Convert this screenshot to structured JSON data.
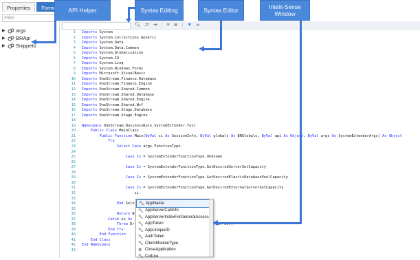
{
  "tabs": [
    "Properties",
    "Formula"
  ],
  "filter": {
    "placeholder": "Filter"
  },
  "tree": [
    "args",
    "BRApi",
    "Snippets"
  ],
  "toolbar": {
    "icons": [
      "find-icon",
      "replace-icon",
      "find-next-icon",
      "comment-icon",
      "uncomment-icon",
      "filter-icon",
      "glasses-icon"
    ]
  },
  "callouts": {
    "api_helper": "API Helper",
    "syntax_editing": "Syntax Editing",
    "syntax_editor": "Syntax Editor",
    "intelli_sense": "Intelli-Sense Window"
  },
  "code_lines": [
    {
      "n": "1",
      "fold": "",
      "t": "Imports System"
    },
    {
      "n": "2",
      "fold": "",
      "t": "Imports System.Collections.Generic"
    },
    {
      "n": "3",
      "fold": "",
      "t": "Imports System.Data"
    },
    {
      "n": "4",
      "fold": "",
      "t": "Imports System.Data.Common"
    },
    {
      "n": "5",
      "fold": "",
      "t": "Imports System.Globalization"
    },
    {
      "n": "6",
      "fold": "",
      "t": "Imports System.IO"
    },
    {
      "n": "7",
      "fold": "",
      "t": "Imports System.Linq"
    },
    {
      "n": "8",
      "fold": "",
      "t": "Imports System.Windows.Forms"
    },
    {
      "n": "9",
      "fold": "",
      "t": "Imports Microsoft.VisualBasic"
    },
    {
      "n": "10",
      "fold": "",
      "t": "Imports OneStream.Finance.Database"
    },
    {
      "n": "11",
      "fold": "",
      "t": "Imports OneStream.Finance.Engine"
    },
    {
      "n": "12",
      "fold": "",
      "t": "Imports OneStream.Shared.Common"
    },
    {
      "n": "13",
      "fold": "",
      "t": "Imports OneStream.Shared.Database"
    },
    {
      "n": "14",
      "fold": "",
      "t": "Imports OneStream.Shared.Engine"
    },
    {
      "n": "15",
      "fold": "",
      "t": "Imports OneStream.Shared.Wcf"
    },
    {
      "n": "16",
      "fold": "",
      "t": "Imports OneStream.Stage.Database"
    },
    {
      "n": "17",
      "fold": "",
      "t": "Imports OneStream.Stage.Engine"
    },
    {
      "n": "18",
      "fold": "",
      "t": ""
    },
    {
      "n": "19",
      "fold": "-",
      "t": "Namespace OneStream.BusinessRule.SystemExtender.Test"
    },
    {
      "n": "20",
      "fold": "-",
      "t": "    Public Class MainClass"
    },
    {
      "n": "21",
      "fold": "-",
      "t": "        Public Function Main(ByVal si As SessionInfo, ByVal globals As BRGlobals, ByVal api As Object, ByVal args As SystemExtenderArgs) As Object"
    },
    {
      "n": "22",
      "fold": "",
      "t": "            Try"
    },
    {
      "n": "23",
      "fold": "",
      "t": "                Select Case args.FunctionType"
    },
    {
      "n": "24",
      "fold": "",
      "t": ""
    },
    {
      "n": "25",
      "fold": "",
      "t": "                    Case Is = SystemExtenderFunctionType.Unknown"
    },
    {
      "n": "26",
      "fold": "",
      "t": ""
    },
    {
      "n": "27",
      "fold": "",
      "t": "                    Case Is = SystemExtenderFunctionType.GetDesiredServerSetCapacity"
    },
    {
      "n": "28",
      "fold": "",
      "t": ""
    },
    {
      "n": "29",
      "fold": "",
      "t": "                    Case Is = SystemExtenderFunctionType.GetDesiredElasticDatabasePoolCapacity"
    },
    {
      "n": "30",
      "fold": "",
      "t": ""
    },
    {
      "n": "31",
      "fold": "",
      "t": "                    Case Is = SystemExtenderFunctionType.GetDesiredExternalServerSetCapacity"
    },
    {
      "n": "32",
      "fold": "",
      "t": "                        si."
    },
    {
      "n": "33",
      "fold": "",
      "t": ""
    },
    {
      "n": "34",
      "fold": "",
      "t": "                End Sele"
    },
    {
      "n": "35",
      "fold": "",
      "t": ""
    },
    {
      "n": "36",
      "fold": "",
      "t": "                Return N"
    },
    {
      "n": "37",
      "fold": "",
      "t": "            Catch ex As"
    },
    {
      "n": "38",
      "fold": "",
      "t": "                Throw Er                              eption(si, ex))"
    },
    {
      "n": "39",
      "fold": "",
      "t": "            End Try"
    },
    {
      "n": "40",
      "fold": "",
      "t": "        End Function"
    },
    {
      "n": "41",
      "fold": "",
      "t": "    End Class"
    },
    {
      "n": "42",
      "fold": "",
      "t": "End Namespace"
    },
    {
      "n": "43",
      "fold": "",
      "t": ""
    }
  ],
  "intellisense": [
    {
      "label": "AppName",
      "icon": "wrench-icon"
    },
    {
      "label": "AppServerCallInfo",
      "icon": "wrench-icon"
    },
    {
      "label": "AppServerIndexForGeneralAccess",
      "icon": "wrench-icon"
    },
    {
      "label": "AppToken",
      "icon": "wrench-icon"
    },
    {
      "label": "AppUniqueID",
      "icon": "wrench-icon"
    },
    {
      "label": "AuthToken",
      "icon": "wrench-icon"
    },
    {
      "label": "ClientModuleType",
      "icon": "wrench-icon"
    },
    {
      "label": "CloseApplication",
      "icon": "method-icon"
    },
    {
      "label": "Culture",
      "icon": "wrench-icon"
    }
  ]
}
